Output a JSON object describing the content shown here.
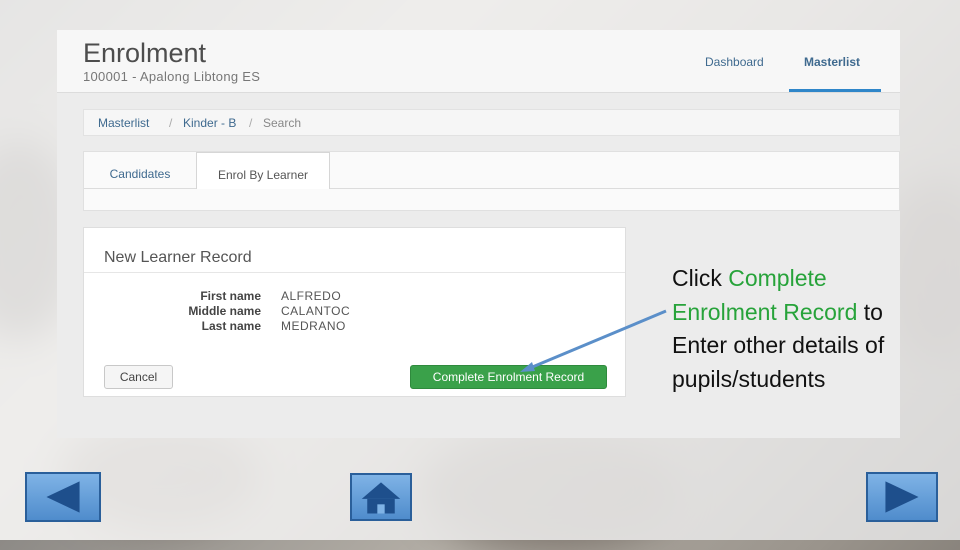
{
  "app": {
    "title": "Enrolment",
    "school_line": "100001 - Apalong Libtong ES"
  },
  "nav": {
    "dashboard": "Dashboard",
    "masterlist": "Masterlist"
  },
  "breadcrumb": {
    "items": [
      "Masterlist",
      "Kinder - B",
      "Search"
    ],
    "separator": "/"
  },
  "tabs": {
    "candidates": "Candidates",
    "enrol_by_learner": "Enrol By Learner"
  },
  "record": {
    "title": "New Learner Record",
    "fields": [
      {
        "label": "First name",
        "value": "ALFREDO"
      },
      {
        "label": "Middle name",
        "value": "CALANTOC"
      },
      {
        "label": "Last name",
        "value": "MEDRANO"
      }
    ],
    "cancel_label": "Cancel",
    "complete_label": "Complete Enrolment Record"
  },
  "callout": {
    "prefix": "Click ",
    "highlight": "Complete Enrolment Record",
    "suffix": " to Enter other details of pupils/students",
    "highlight_color": "#27a33a",
    "arrow_color": "#5b8fc9"
  },
  "slide_nav": {
    "prev_icon": "left-triangle-icon",
    "home_icon": "home-icon",
    "next_icon": "right-triangle-icon"
  }
}
